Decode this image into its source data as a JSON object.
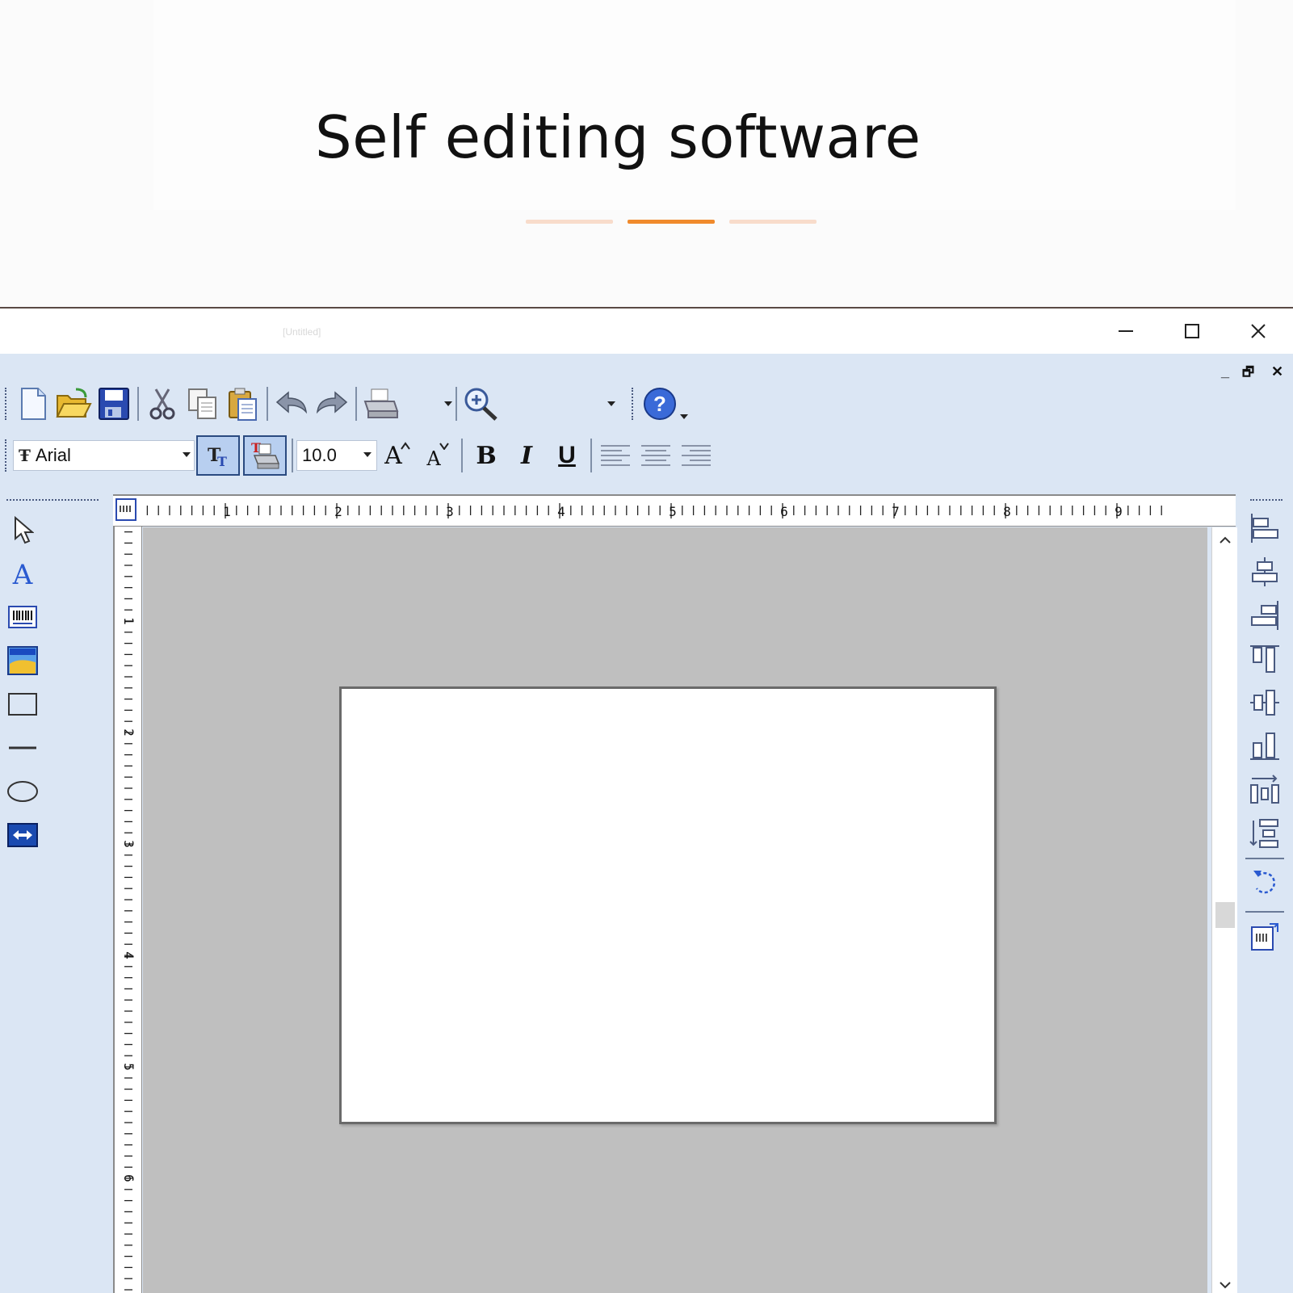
{
  "banner": {
    "title": "Self editing software",
    "dot_colors": [
      "#f8dccb",
      "#f08a2c",
      "#f8dccb"
    ]
  },
  "window": {
    "title": "[Untitled]",
    "controls": [
      "minimize-icon",
      "maximize-icon",
      "close-icon"
    ],
    "mdi_controls": [
      "_",
      "🗗",
      "✕"
    ]
  },
  "toolbar_standard": {
    "buttons": [
      "new-file-icon",
      "open-folder-icon",
      "save-icon",
      "cut-icon",
      "copy-icon",
      "paste-icon",
      "undo-icon",
      "redo-icon",
      "print-icon",
      "zoom-in-icon",
      "help-icon"
    ]
  },
  "toolbar_format": {
    "font_name": "Arial",
    "font_size": "10.0",
    "bold": "B",
    "italic": "I",
    "underline": "U",
    "increase_font": "A",
    "decrease_font": "A"
  },
  "ruler": {
    "horizontal_labels": [
      "1",
      "2",
      "3",
      "4",
      "5",
      "6",
      "7",
      "8",
      "9"
    ],
    "vertical_labels": [
      "1",
      "2",
      "3",
      "4",
      "5",
      "6"
    ]
  },
  "left_tools": [
    "pointer-icon",
    "text-tool-icon",
    "barcode-tool-icon",
    "image-tool-icon",
    "rectangle-tool-icon",
    "line-tool-icon",
    "ellipse-tool-icon",
    "database-tool-icon"
  ],
  "right_tools": [
    "align-left-icon",
    "align-center-icon",
    "align-right-icon",
    "align-top-icon",
    "align-middle-icon",
    "align-bottom-icon",
    "distribute-horizontal-icon",
    "distribute-vertical-icon",
    "rotate-icon",
    "label-setup-icon"
  ],
  "accent": "#f08a2c",
  "app_background": "#dbe6f4",
  "canvas_background": "#bfbfbf"
}
